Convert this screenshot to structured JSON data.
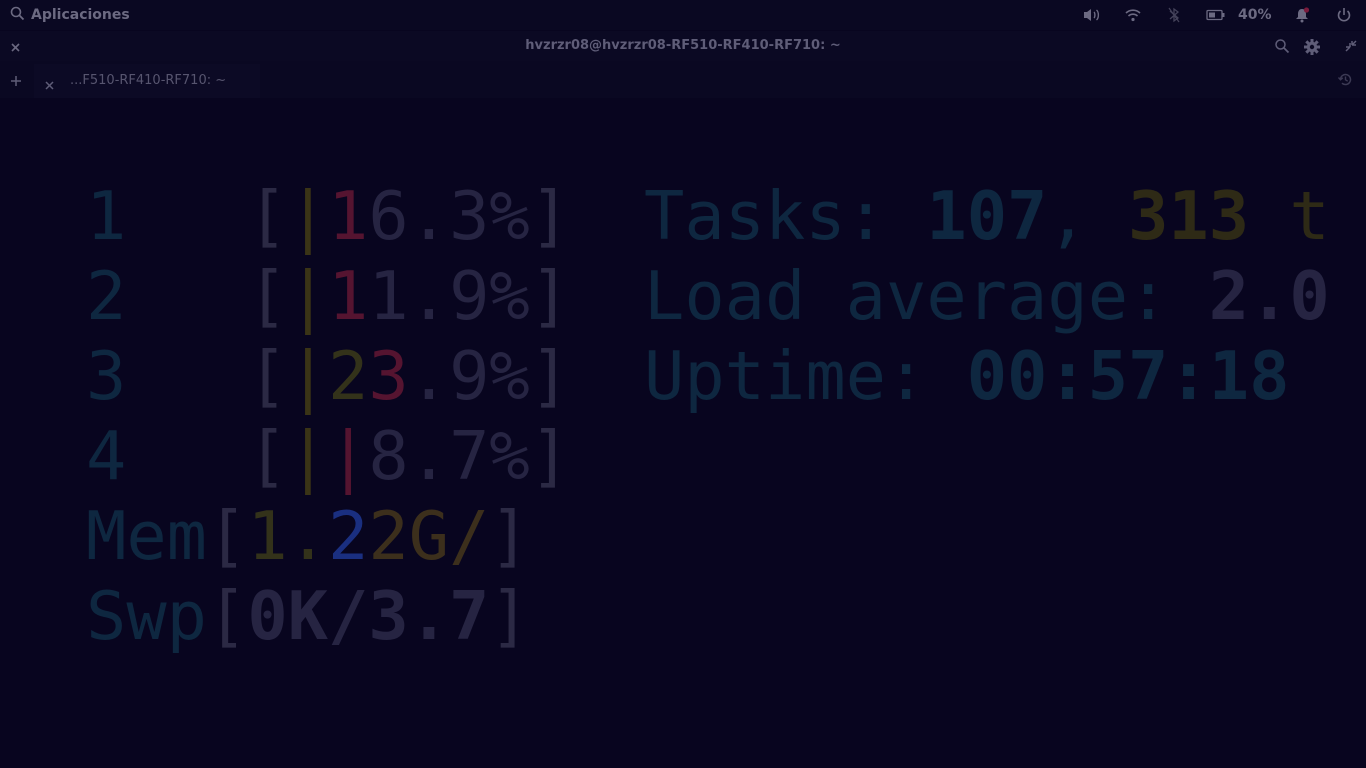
{
  "panel": {
    "applications_label": "Aplicaciones",
    "battery_percent": "40%",
    "icons": [
      "search-icon",
      "volume-icon",
      "wifi-icon",
      "bluetooth-icon",
      "battery-icon",
      "notification-bell-icon",
      "power-icon"
    ]
  },
  "window": {
    "title": "hvzrzr08@hvzrzr08-RF510-RF410-RF710: ~",
    "tabs": [
      {
        "label": "...F510-RF410-RF710: ~"
      }
    ]
  },
  "htop": {
    "cpus": [
      {
        "id": "1",
        "open": "[",
        "bars": [
          {
            "text": "|",
            "color": "yellow"
          }
        ],
        "percent_parts": [
          {
            "text": "1",
            "color": "red"
          },
          {
            "text": "6.3%",
            "color": "gray"
          }
        ],
        "close": "]"
      },
      {
        "id": "2",
        "open": "[",
        "bars": [
          {
            "text": "|",
            "color": "yellow"
          }
        ],
        "percent_parts": [
          {
            "text": "1",
            "color": "red"
          },
          {
            "text": "1.9%",
            "color": "gray"
          }
        ],
        "close": "]"
      },
      {
        "id": "3",
        "open": "[",
        "bars": [
          {
            "text": "|",
            "color": "yellow"
          }
        ],
        "percent_parts": [
          {
            "text": "2",
            "color": "yellow"
          },
          {
            "text": "3",
            "color": "red"
          },
          {
            "text": ".9%",
            "color": "gray"
          }
        ],
        "close": "]"
      },
      {
        "id": "4",
        "open": "[",
        "bars": [
          {
            "text": "|",
            "color": "yellow"
          },
          {
            "text": "|",
            "color": "red"
          }
        ],
        "percent_parts": [
          {
            "text": "8.7%",
            "color": "gray"
          }
        ],
        "close": "]"
      }
    ],
    "mem": {
      "label": "Mem",
      "open": "[",
      "parts": [
        "1.",
        "2",
        "2G/"
      ],
      "close": "]"
    },
    "swap": {
      "label": "Swp",
      "open": "[",
      "value": "0K/3.7",
      "close": "]"
    },
    "tasks": {
      "label": "Tasks: ",
      "count": "107",
      "sep": ", ",
      "threads": "313",
      "suffix": " t"
    },
    "load": {
      "label": "Load average: ",
      "value": "2.0"
    },
    "uptime": {
      "label": "Uptime: ",
      "value": "00:57:18"
    }
  },
  "colors": {
    "background": "#08051f",
    "cyan_dim": "#0e2740",
    "yellow_dim": "#3a3416",
    "red_dim": "#551430",
    "blue_dim": "#1a2f80"
  }
}
